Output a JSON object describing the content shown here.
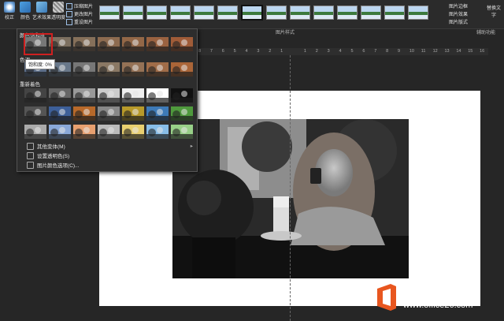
{
  "ribbon": {
    "correct_label": "校正",
    "color_label": "颜色",
    "art_effects_label": "艺术效果",
    "transparency_label": "透明度",
    "compress_label": "压缩图片",
    "change_pic_label": "更改图片",
    "reset_pic_label": "重设图片",
    "picture_border_label": "图片边框",
    "picture_effects_label": "图片效果",
    "picture_layout_label": "图片版式",
    "alt_text_label": "替换文字",
    "group_label": "图片样式",
    "accessibility_label": "辅助功能"
  },
  "ruler": {
    "ticks": [
      "8",
      "7",
      "6",
      "5",
      "4",
      "3",
      "2",
      "1",
      "",
      "1",
      "2",
      "3",
      "4",
      "5",
      "6",
      "7",
      "8",
      "9",
      "10",
      "11",
      "12",
      "13",
      "14",
      "15",
      "16"
    ]
  },
  "dropdown": {
    "saturation_title": "颜色饱和度",
    "tone_title": "色调",
    "recolor_title": "重新着色",
    "tooltip": "饱和度: 0%",
    "menu": [
      {
        "label": "其他变体(M)"
      },
      {
        "label": "设置透明色(S)"
      },
      {
        "label": "图片颜色选项(C)..."
      }
    ]
  },
  "watermark": {
    "brand": "Office教程网",
    "url": "www.office26.com"
  },
  "colors": {
    "accent": "#d02020",
    "brand": "#e8561f"
  }
}
